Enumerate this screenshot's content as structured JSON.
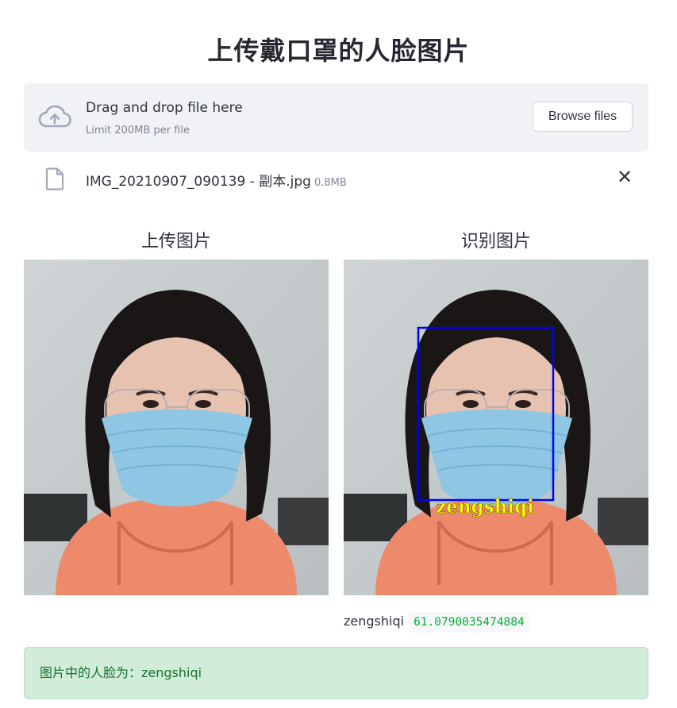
{
  "page": {
    "title": "上传戴口罩的人脸图片"
  },
  "uploader": {
    "drag_text": "Drag and drop file here",
    "limit_text": "Limit 200MB per file",
    "browse_label": "Browse files",
    "icon": "cloud-upload-icon"
  },
  "file": {
    "name": "IMG_20210907_090139 - 副本.jpg",
    "size": "0.8MB",
    "icon": "file-icon",
    "remove_icon": "close-icon"
  },
  "columns": {
    "left_title": "上传图片",
    "right_title": "识别图片"
  },
  "detection": {
    "box_label": "zengshiqi",
    "box_color": "#0000ff",
    "label_color": "#ffff00"
  },
  "result": {
    "name": "zengshiqi",
    "score": "61.0790035474884",
    "message": "图片中的人脸为：zengshiqi"
  },
  "colors": {
    "dropzone_bg": "#f0f2f6",
    "success_bg": "#d1ecd8",
    "success_text": "#177233",
    "score_text": "#09ab3b"
  }
}
